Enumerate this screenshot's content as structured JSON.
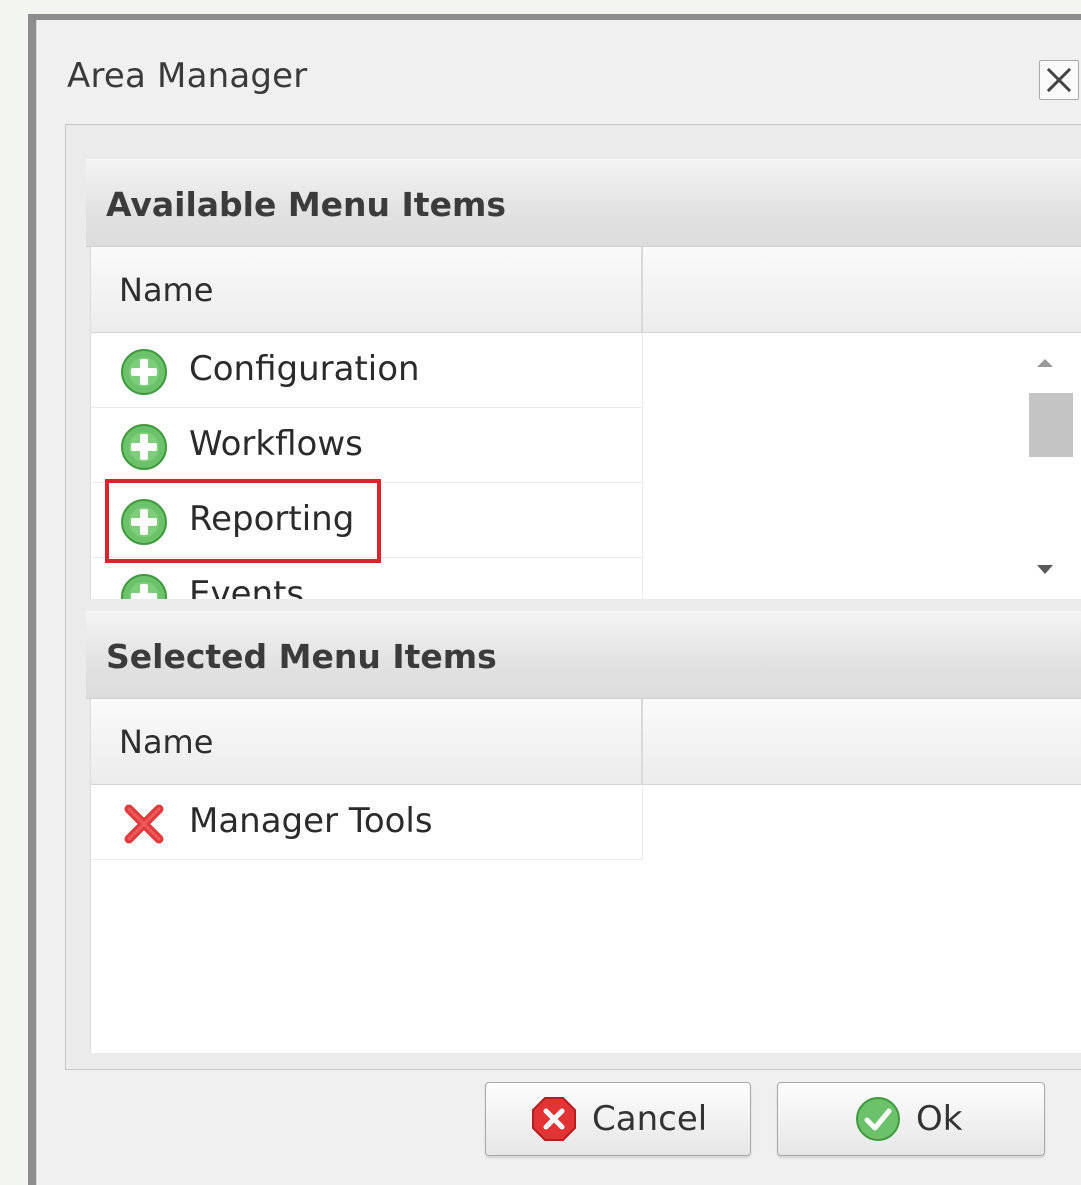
{
  "dialog": {
    "title": "Area Manager"
  },
  "available": {
    "header": "Available Menu Items",
    "column_name": "Name",
    "items": [
      {
        "label": "Configuration",
        "icon": "add-icon"
      },
      {
        "label": "Workflows",
        "icon": "add-icon"
      },
      {
        "label": "Reporting",
        "icon": "add-icon",
        "highlighted": true
      },
      {
        "label": "Events",
        "icon": "add-icon"
      }
    ]
  },
  "selected": {
    "header": "Selected Menu Items",
    "column_name": "Name",
    "items": [
      {
        "label": "Manager Tools",
        "icon": "remove-icon"
      }
    ]
  },
  "buttons": {
    "cancel": "Cancel",
    "ok": "Ok"
  },
  "colors": {
    "highlight": "#d8242c",
    "add_icon": "#5cb85c",
    "remove_icon": "#e03a3a"
  }
}
